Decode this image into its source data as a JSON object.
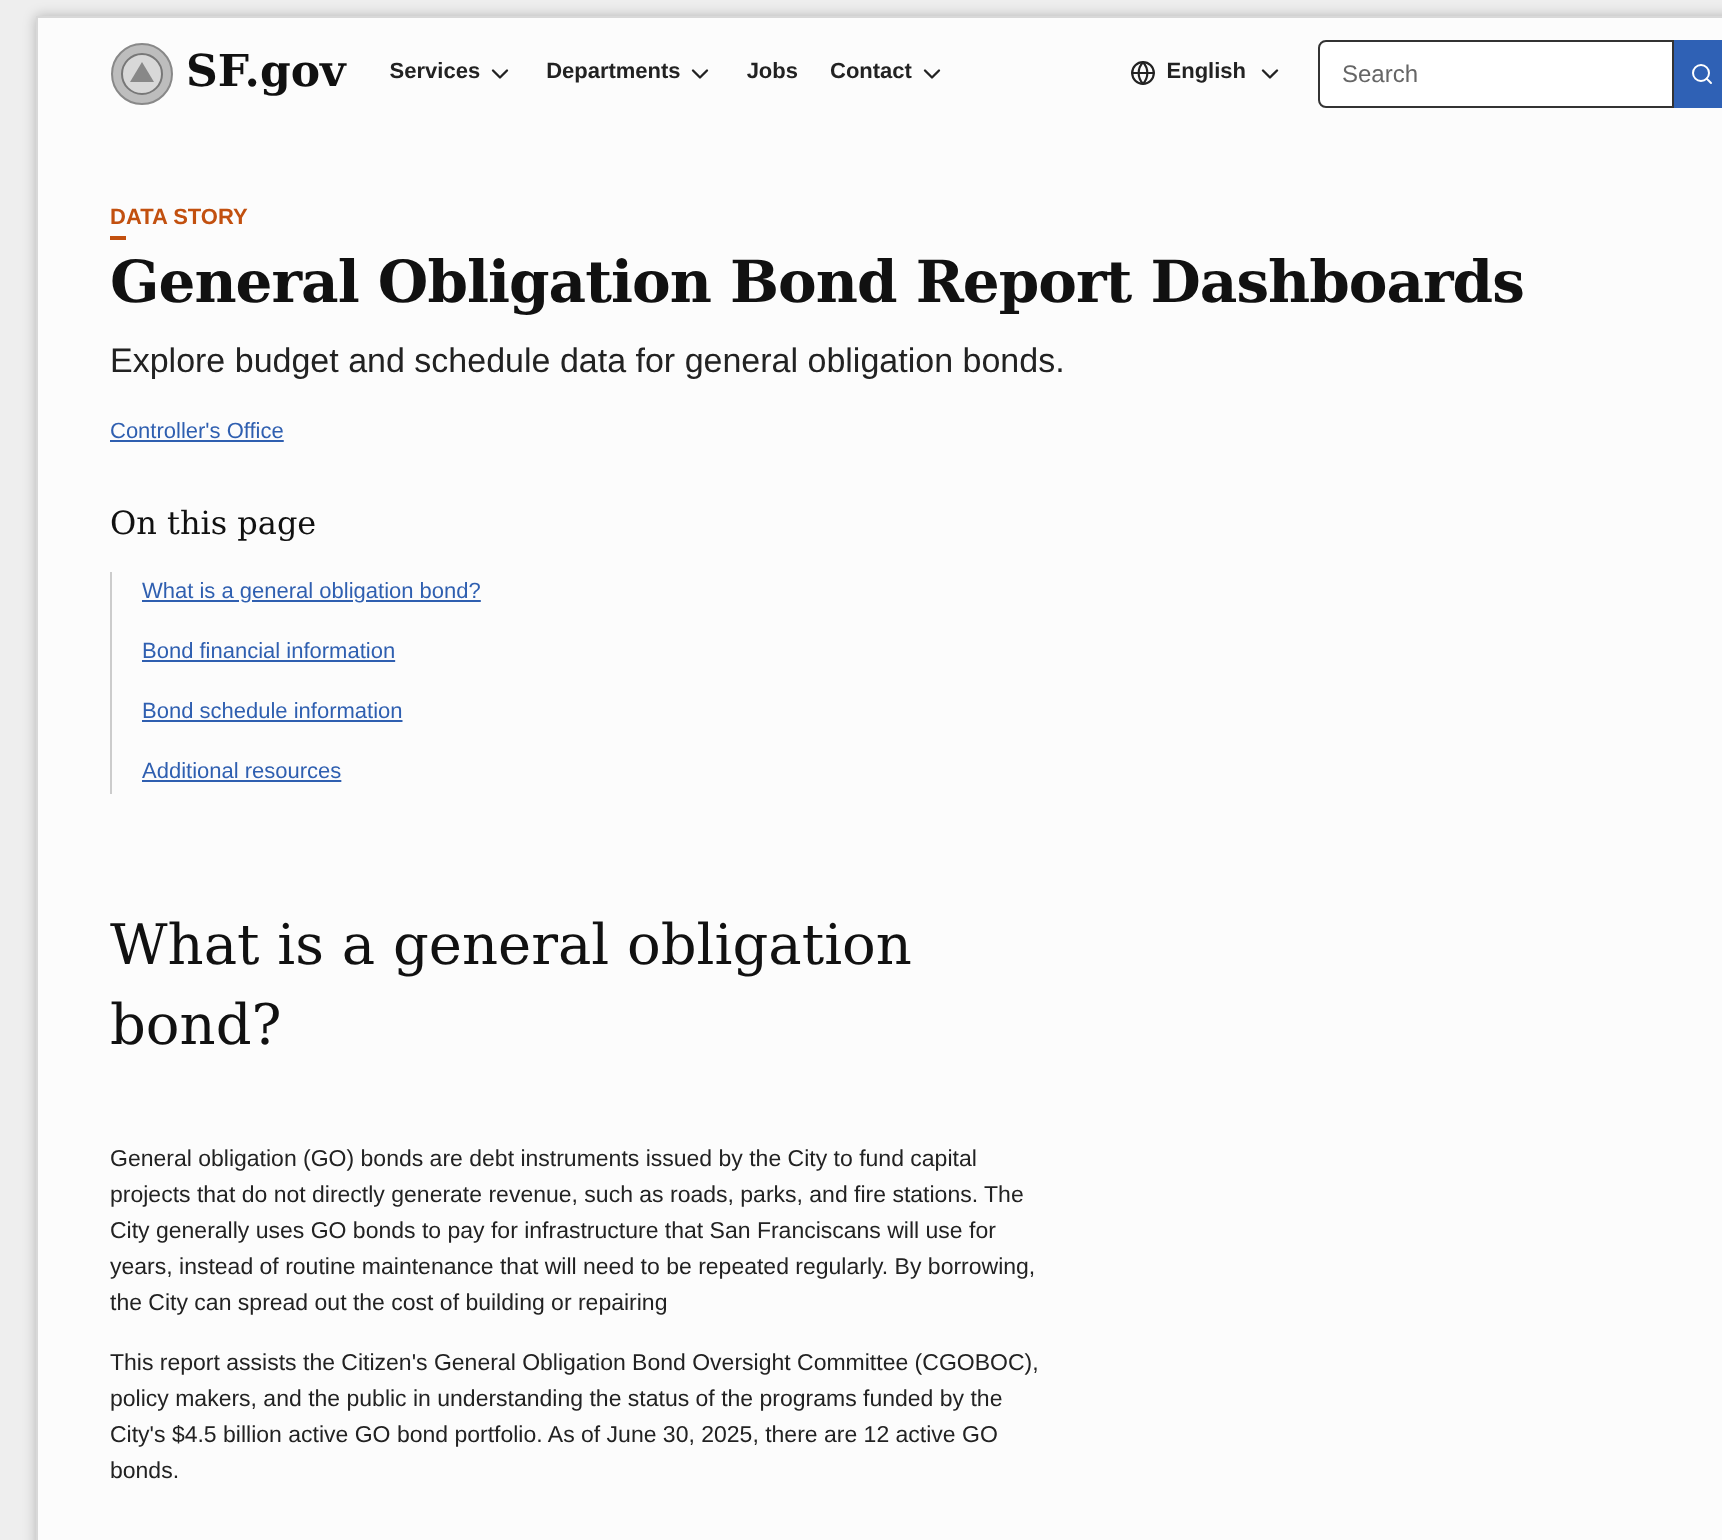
{
  "header": {
    "logo": "SF.gov",
    "nav": [
      {
        "label": "Services",
        "dropdown": true
      },
      {
        "label": "Departments",
        "dropdown": true
      },
      {
        "label": "Jobs",
        "dropdown": false
      },
      {
        "label": "Contact",
        "dropdown": true
      }
    ],
    "language": "English",
    "search": {
      "placeholder": "Search"
    }
  },
  "eyebrow": "DATA STORY",
  "title": "General Obligation Bond Report Dashboards",
  "subtitle": "Explore budget and schedule data for general obligation bonds.",
  "department_link": "Controller's Office",
  "on_this_page": {
    "heading": "On this page",
    "links": [
      "What is a general obligation bond?",
      "Bond financial information",
      "Bond schedule information",
      "Additional resources"
    ]
  },
  "section": {
    "heading": "What is a general obligation bond?",
    "paragraphs": [
      "General obligation (GO) bonds are debt instruments issued by the City to fund capital projects that do not directly generate revenue, such as roads, parks, and fire stations. The City generally uses GO bonds to pay for infrastructure that San Franciscans will use for years, instead of routine maintenance that will need to be repeated regularly. By borrowing, the City can spread out the cost of building or repairing",
      "This report assists the Citizen's General Obligation Bond Oversight Committee (CGOBOC), policy makers, and the public in understanding the status of the programs funded by the City's $4.5 billion active GO bond portfolio. As of June 30, 2025, there are 12 active GO bonds."
    ]
  }
}
